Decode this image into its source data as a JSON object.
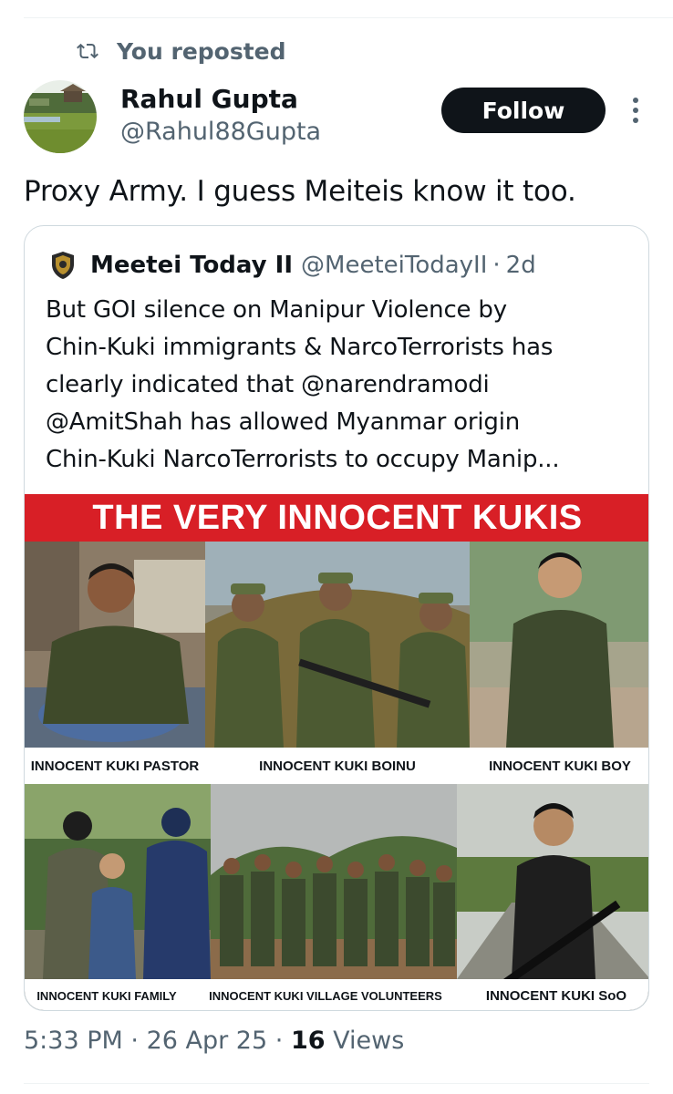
{
  "repost": {
    "text": "You reposted"
  },
  "author": {
    "name": "Rahul Gupta",
    "handle": "@Rahul88Gupta"
  },
  "follow_label": "Follow",
  "tweet_text": "Proxy Army. I guess Meiteis know it too.",
  "quote": {
    "name": "Meetei Today II",
    "handle": "@MeeteiTodayII",
    "separator": "·",
    "time": "2d",
    "body": "But GOI silence on Manipur Violence by\nChin-Kuki immigrants & NarcoTerrorists has\nclearly indicated that @narendramodi\n@AmitShah has allowed Myanmar origin\nChin-Kuki NarcoTerrorists to occupy Manip..."
  },
  "image": {
    "banner": "THE VERY INNOCENT KUKIS",
    "captions": [
      "INNOCENT KUKI PASTOR",
      "INNOCENT KUKI BOINU",
      "INNOCENT KUKI BOY",
      "INNOCENT KUKI FAMILY",
      "INNOCENT  KUKI VILLAGE VOLUNTEERS",
      "INNOCENT KUKI SoO"
    ],
    "banner_color": "#d81f26"
  },
  "footer": {
    "time": "5:33 PM",
    "sep1": "·",
    "date": "26 Apr 25",
    "sep2": "·",
    "views": "16",
    "views_label": "Views"
  },
  "colors": {
    "text_primary": "#0f1419",
    "text_secondary": "#536471",
    "border": "#cfd9de"
  },
  "icons": {
    "repost": "repost-icon",
    "more": "more-vertical-icon"
  }
}
